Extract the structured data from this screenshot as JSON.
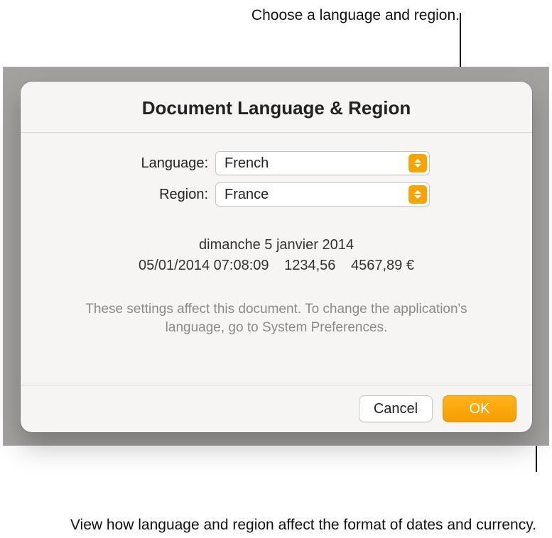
{
  "callouts": {
    "top": "Choose a language and region.",
    "bottom": "View how language and region affect the format of dates and currency."
  },
  "dialog": {
    "title": "Document Language & Region",
    "language": {
      "label": "Language:",
      "value": "French"
    },
    "region": {
      "label": "Region:",
      "value": "France"
    },
    "preview": {
      "long_date": "dimanche 5 janvier 2014",
      "datetime": "05/01/2014 07:08:09",
      "number": "1234,56",
      "currency": "4567,89 €"
    },
    "help": "These settings affect this document. To change the application's language, go to System Preferences.",
    "buttons": {
      "cancel": "Cancel",
      "ok": "OK"
    }
  },
  "colors": {
    "accent": "#f7a400"
  }
}
